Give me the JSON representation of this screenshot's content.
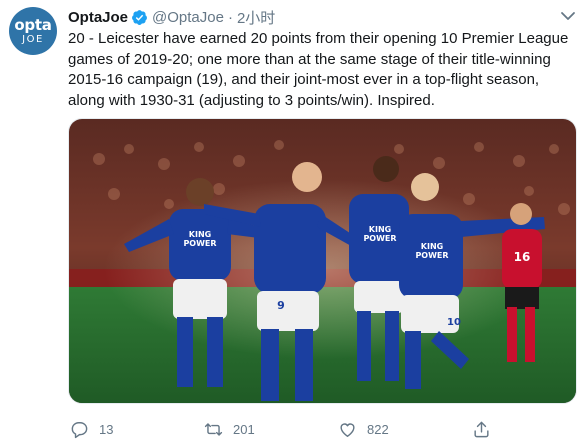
{
  "author": {
    "display_name": "OptaJoe",
    "handle": "@OptaJoe",
    "separator": "·",
    "time": "2小时",
    "avatar_text_line1": "opta",
    "avatar_text_line2": "JOE",
    "avatar_color": "#2f74a8",
    "verified_icon": "verified-badge-icon"
  },
  "tweet": {
    "text": "20 - Leicester have earned 20 points from their opening 10 Premier League games of 2019-20; one more than at the same stage of their title-winning 2015-16 campaign (19), and their joint-most ever in a top-flight season, along with 1930-31 (adjusting to 3 points/win). Inspired.",
    "photo_kit_text_line1": "KING",
    "photo_kit_text_line2": "POWER",
    "photo_shirt_number_left": "9",
    "photo_shirt_number_right": "10",
    "photo_opponent_number": "16"
  },
  "actions": {
    "reply": {
      "icon": "reply-icon",
      "count": "13"
    },
    "retweet": {
      "icon": "retweet-icon",
      "count": "201"
    },
    "like": {
      "icon": "like-icon",
      "count": "822"
    },
    "share": {
      "icon": "share-icon"
    }
  },
  "colors": {
    "text_primary": "#14171a",
    "text_secondary": "#657786",
    "verified_blue": "#1da1f2",
    "leicester_blue": "#1b3fa0"
  }
}
